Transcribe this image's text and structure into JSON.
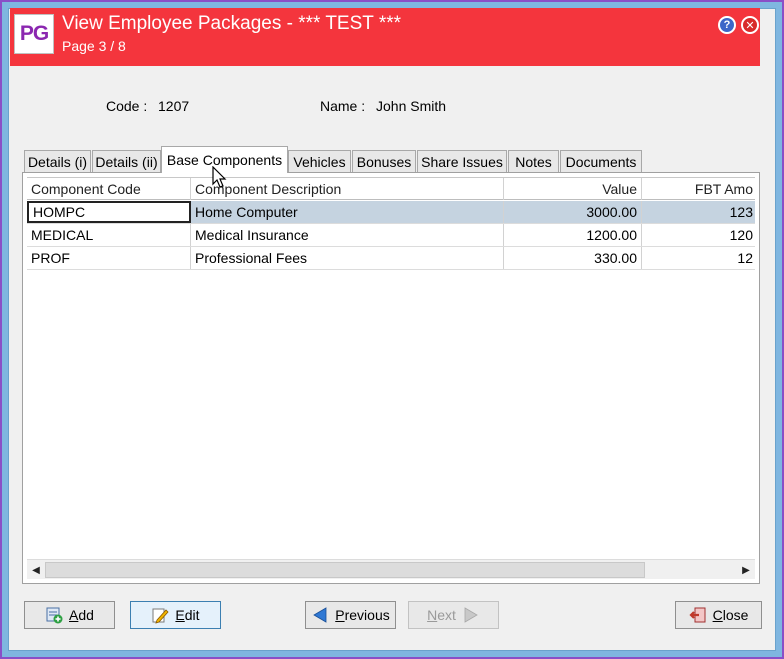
{
  "window": {
    "logo_text": "PG",
    "title": "View Employee Packages - *** TEST ***",
    "subtitle": "Page 3 / 8",
    "help_glyph": "?",
    "close_glyph": "✕"
  },
  "info": {
    "code_label": "Code :",
    "code_value": "1207",
    "name_label": "Name :",
    "name_value": "John Smith"
  },
  "tabs": [
    {
      "label": "Details (i)"
    },
    {
      "label": "Details (ii)"
    },
    {
      "label": "Base Components"
    },
    {
      "label": "Vehicles"
    },
    {
      "label": "Bonuses"
    },
    {
      "label": "Share Issues"
    },
    {
      "label": "Notes"
    },
    {
      "label": "Documents"
    }
  ],
  "table": {
    "columns": [
      "Component Code",
      "Component Description",
      "Value",
      "FBT Amo"
    ],
    "rows": [
      {
        "code": "HOMPC",
        "description": "Home Computer",
        "value": "3000.00",
        "fbt": "123"
      },
      {
        "code": "MEDICAL",
        "description": "Medical Insurance",
        "value": "1200.00",
        "fbt": "120"
      },
      {
        "code": "PROF",
        "description": "Professional Fees",
        "value": "330.00",
        "fbt": "12"
      }
    ]
  },
  "buttons": {
    "add": {
      "accel": "A",
      "rest": "dd"
    },
    "edit": {
      "accel": "E",
      "rest": "dit"
    },
    "previous": {
      "accel": "P",
      "rest": "revious"
    },
    "next": {
      "accel": "N",
      "rest": "ext"
    },
    "close": {
      "accel": "C",
      "rest": "lose"
    }
  },
  "colors": {
    "titlebar": "#f4353d",
    "selected_row": "#c5d3e0",
    "logo_text": "#8b27b0"
  }
}
